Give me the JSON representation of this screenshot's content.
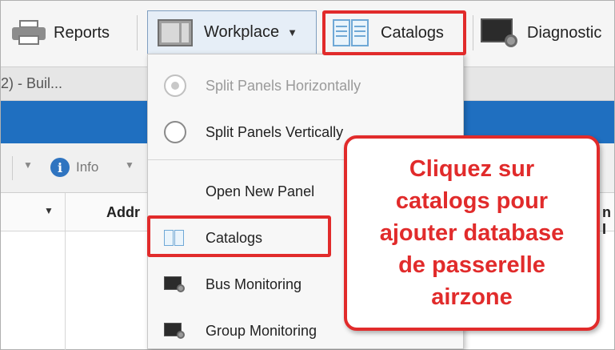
{
  "toolbar": {
    "reports_label": "Reports",
    "workplace_label": "Workplace",
    "catalogs_label": "Catalogs",
    "diagnostics_label": "Diagnostic"
  },
  "document_tab": "2) - Buil...",
  "subtoolbar": {
    "info_label": "Info"
  },
  "grid": {
    "column_address": "Addr",
    "column_right": "n I"
  },
  "workplace_menu": {
    "items": [
      {
        "label": "Split Panels Horizontally",
        "enabled": false,
        "type": "radio"
      },
      {
        "label": "Split Panels Vertically",
        "enabled": true,
        "type": "radio"
      },
      {
        "label": "Open New Panel",
        "enabled": true,
        "type": "command"
      },
      {
        "label": "Catalogs",
        "enabled": true,
        "type": "command",
        "icon": "catalog-book-icon"
      },
      {
        "label": "Bus Monitoring",
        "enabled": true,
        "type": "command",
        "icon": "monitor-icon"
      },
      {
        "label": "Group Monitoring",
        "enabled": true,
        "type": "command",
        "icon": "monitor-icon"
      }
    ]
  },
  "callout": {
    "lines": [
      "Cliquez sur",
      "catalogs pour",
      "ajouter database",
      "de passerelle",
      "airzone"
    ]
  },
  "colors": {
    "highlight": "#e12b2b",
    "blue_bar": "#1f6fc0",
    "workplace_active_bg": "#e6eef7"
  }
}
